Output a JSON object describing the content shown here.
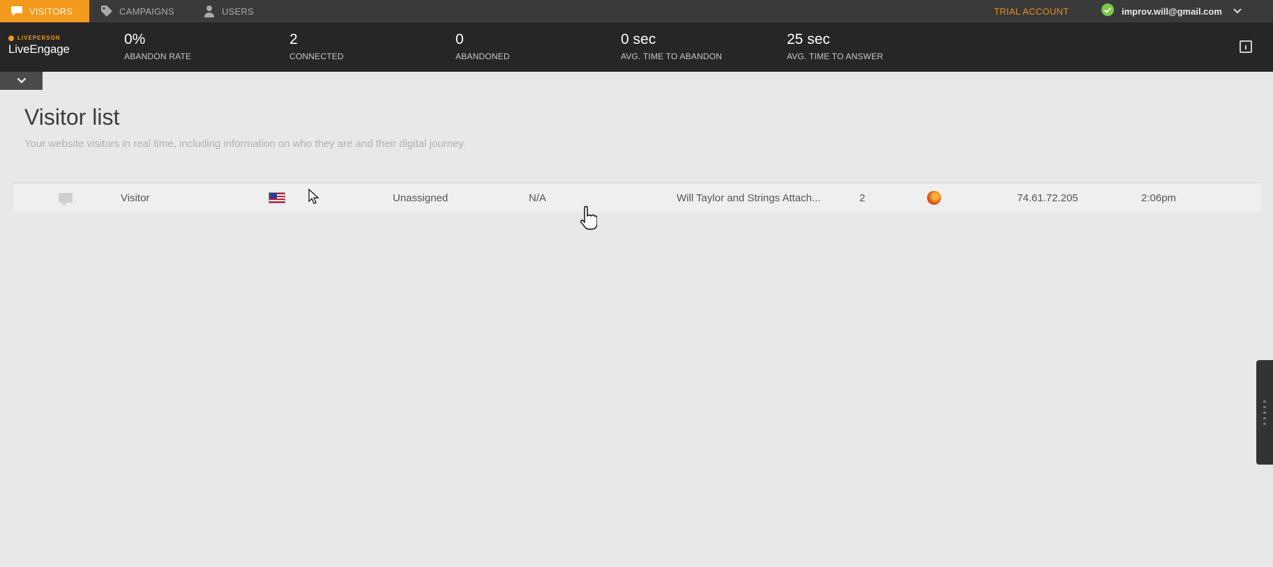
{
  "nav": {
    "tabs": [
      {
        "label": "VISITORS",
        "icon": "chat-bubble-icon",
        "active": true
      },
      {
        "label": "CAMPAIGNS",
        "icon": "tag-icon",
        "active": false
      },
      {
        "label": "USERS",
        "icon": "user-icon",
        "active": false
      }
    ],
    "trial_label": "TRIAL ACCOUNT",
    "user_email": "improv.will@gmail.com",
    "status_icon": "green-check-icon",
    "accent_color": "#f39a1c"
  },
  "brand": {
    "top_text": "LIVEPERSON",
    "name": "LiveEngage"
  },
  "stats": [
    {
      "value": "0%",
      "label": "ABANDON RATE"
    },
    {
      "value": "2",
      "label": "CONNECTED"
    },
    {
      "value": "0",
      "label": "ABANDONED"
    },
    {
      "value": "0 sec",
      "label": "AVG. TIME TO ABANDON"
    },
    {
      "value": "25 sec",
      "label": "AVG. TIME TO ANSWER"
    }
  ],
  "page": {
    "title": "Visitor list",
    "subtitle": "Your website visitors in real time, including information on who they are and their digital journey."
  },
  "visitors": [
    {
      "name": "Visitor",
      "country_flag": "us-flag-icon",
      "assignment": "Unassigned",
      "engagement": "N/A",
      "page_title": "Will Taylor and Strings Attach...",
      "visits": "2",
      "browser": "firefox-icon",
      "ip": "74.61.72.205",
      "time": "2:06pm"
    }
  ]
}
